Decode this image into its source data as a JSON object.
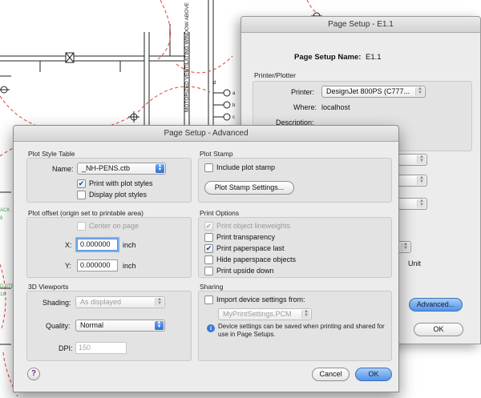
{
  "cad": {
    "vertical_label": "MOTORIZED VENTILATING WINDOW ABOVE",
    "left_labels": [
      "ACK",
      "8",
      "D STE",
      "18"
    ],
    "switch_labels": [
      "a",
      "b",
      "c",
      "d"
    ]
  },
  "back_dialog": {
    "title": "Page Setup - E1.1",
    "page_setup_name_label": "Page Setup Name:",
    "page_setup_name_value": "E1.1",
    "printer_group_title": "Printer/Plotter",
    "printer_label": "Printer:",
    "printer_value": "DesignJet 800PS (C777...",
    "where_label": "Where:",
    "where_value": "localhost",
    "description_label": "Description:",
    "unit_label": "Unit",
    "advanced_button": "Advanced...",
    "ok_button": "OK"
  },
  "advanced": {
    "title": "Page Setup - Advanced",
    "plot_style_table": {
      "title": "Plot Style Table",
      "name_label": "Name:",
      "name_value": "_NH-PENS.ctb",
      "print_with_plot_styles": "Print with plot styles",
      "print_with_plot_styles_checked": true,
      "display_plot_styles": "Display plot styles",
      "display_plot_styles_checked": false
    },
    "plot_stamp": {
      "title": "Plot Stamp",
      "include_plot_stamp": "Include plot stamp",
      "include_checked": false,
      "settings_button": "Plot Stamp Settings..."
    },
    "plot_offset": {
      "title": "Plot offset (origin set to printable area)",
      "center_on_page": "Center on page",
      "center_checked": false,
      "x_label": "X:",
      "x_value": "0.000000",
      "x_unit": "inch",
      "y_label": "Y:",
      "y_value": "0.000000",
      "y_unit": "inch"
    },
    "print_options": {
      "title": "Print Options",
      "items": [
        {
          "label": "Print object lineweights",
          "checked": true,
          "disabled": true
        },
        {
          "label": "Print transparency",
          "checked": false,
          "disabled": false
        },
        {
          "label": "Print paperspace last",
          "checked": true,
          "disabled": false
        },
        {
          "label": "Hide paperspace objects",
          "checked": false,
          "disabled": false
        },
        {
          "label": "Print upside down",
          "checked": false,
          "disabled": false
        }
      ]
    },
    "viewports_3d": {
      "title": "3D Viewports",
      "shading_label": "Shading:",
      "shading_value": "As displayed",
      "quality_label": "Quality:",
      "quality_value": "Normal",
      "dpi_label": "DPI:",
      "dpi_value": "150"
    },
    "sharing": {
      "title": "Sharing",
      "import_label": "Import device settings from:",
      "import_checked": false,
      "file_value": "MyPrintSettings.PCM",
      "info_text": "Device settings can be saved when printing and shared for use in Page Setups."
    },
    "help_glyph": "?",
    "cancel_button": "Cancel",
    "ok_button": "OK"
  },
  "colors": {
    "cad_dash_red": "#d9433a",
    "cad_green": "#4caf50",
    "accent_blue": "#4f93ea"
  }
}
